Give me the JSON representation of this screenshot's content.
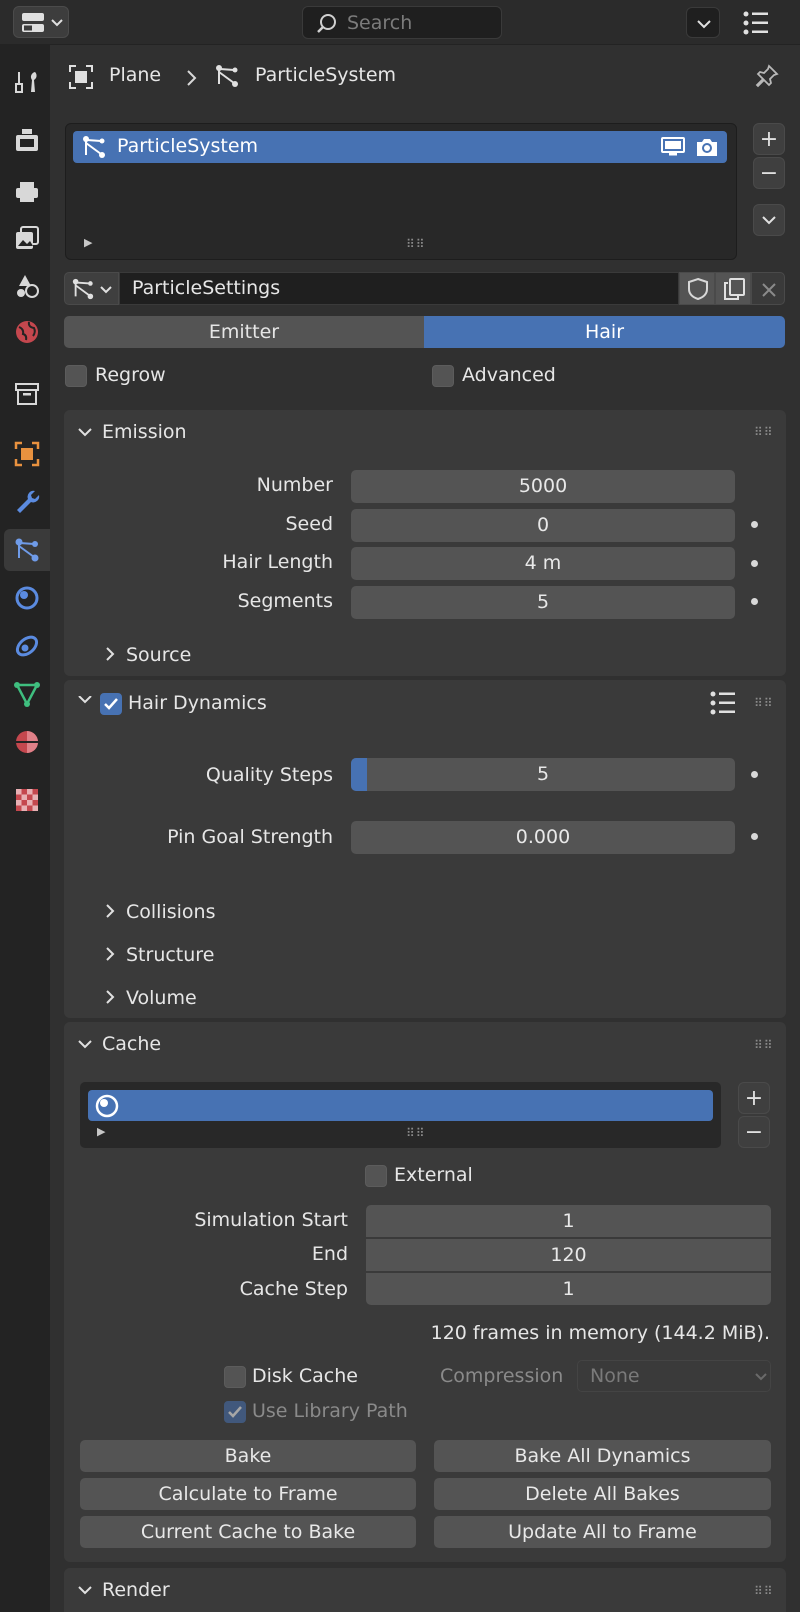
{
  "header": {
    "search_placeholder": "Search"
  },
  "breadcrumb": {
    "object": "Plane",
    "particle_system": "ParticleSystem"
  },
  "particle_list": {
    "items": [
      "ParticleSystem"
    ]
  },
  "settings": {
    "name": "ParticleSettings"
  },
  "type_tabs": {
    "emitter": "Emitter",
    "hair": "Hair",
    "selected": "Hair"
  },
  "options": {
    "regrow": "Regrow",
    "advanced": "Advanced"
  },
  "emission": {
    "title": "Emission",
    "number_label": "Number",
    "number_value": "5000",
    "seed_label": "Seed",
    "seed_value": "0",
    "hair_length_label": "Hair Length",
    "hair_length_value": "4 m",
    "segments_label": "Segments",
    "segments_value": "5",
    "source_label": "Source"
  },
  "hair_dynamics": {
    "title": "Hair Dynamics",
    "enabled": true,
    "quality_steps_label": "Quality Steps",
    "quality_steps_value": "5",
    "pin_goal_label": "Pin Goal Strength",
    "pin_goal_value": "0.000",
    "collisions": "Collisions",
    "structure": "Structure",
    "volume": "Volume"
  },
  "cache": {
    "title": "Cache",
    "external": "External",
    "sim_start_label": "Simulation Start",
    "sim_start_value": "1",
    "end_label": "End",
    "end_value": "120",
    "cache_step_label": "Cache Step",
    "cache_step_value": "1",
    "info": "120 frames in memory (144.2 MiB).",
    "disk_cache": "Disk Cache",
    "compression_label": "Compression",
    "compression_value": "None",
    "use_library_path": "Use Library Path",
    "buttons": {
      "bake": "Bake",
      "bake_all": "Bake All Dynamics",
      "calc_to_frame": "Calculate to Frame",
      "delete_all": "Delete All Bakes",
      "current_to_bake": "Current Cache to Bake",
      "update_all": "Update All to Frame"
    }
  },
  "render": {
    "title": "Render"
  },
  "colors": {
    "accent": "#4772b3",
    "panel": "#3a3a3a",
    "field": "#545454"
  }
}
